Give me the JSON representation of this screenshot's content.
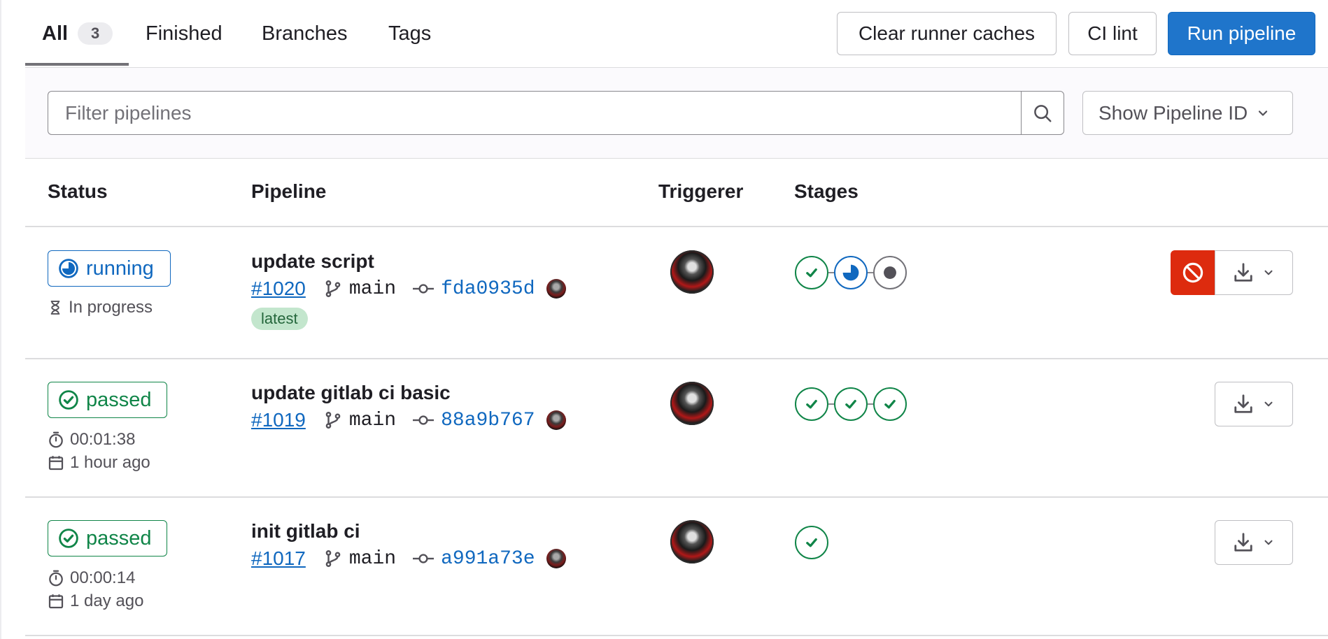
{
  "tabs": [
    {
      "label": "All",
      "count": "3",
      "active": true
    },
    {
      "label": "Finished"
    },
    {
      "label": "Branches"
    },
    {
      "label": "Tags"
    }
  ],
  "actions": {
    "clear_caches": "Clear runner caches",
    "ci_lint": "CI lint",
    "run_pipeline": "Run pipeline"
  },
  "filter": {
    "placeholder": "Filter pipelines",
    "display_option": "Show Pipeline ID"
  },
  "table": {
    "headers": {
      "status": "Status",
      "pipeline": "Pipeline",
      "triggerer": "Triggerer",
      "stages": "Stages"
    },
    "rows": [
      {
        "status": "running",
        "status_detail": "In progress",
        "title": "update script",
        "id": "#1020",
        "branch": "main",
        "sha": "fda0935d",
        "badge": "latest",
        "stages": [
          "success",
          "running",
          "created"
        ],
        "can_cancel": true
      },
      {
        "status": "passed",
        "duration": "00:01:38",
        "finished": "1 hour ago",
        "title": "update gitlab ci basic",
        "id": "#1019",
        "branch": "main",
        "sha": "88a9b767",
        "stages": [
          "success",
          "success",
          "success"
        ]
      },
      {
        "status": "passed",
        "duration": "00:00:14",
        "finished": "1 day ago",
        "title": "init gitlab ci",
        "id": "#1017",
        "branch": "main",
        "sha": "a991a73e",
        "stages": [
          "success"
        ]
      }
    ]
  },
  "colors": {
    "primary": "#1f75cb",
    "success": "#108548",
    "running": "#1068bf",
    "danger": "#dd2b0e",
    "latest_badge_bg": "#c3e6cd"
  }
}
